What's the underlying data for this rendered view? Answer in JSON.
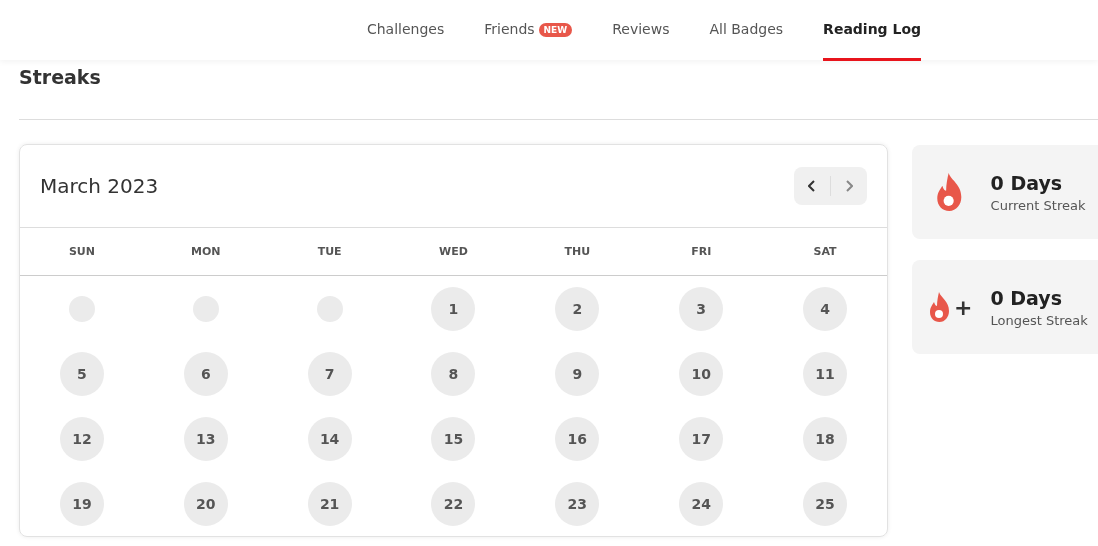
{
  "tabs": [
    {
      "label": "Challenges",
      "selected": false
    },
    {
      "label": "Friends",
      "selected": false,
      "badge": "NEW"
    },
    {
      "label": "Reviews",
      "selected": false
    },
    {
      "label": "All Badges",
      "selected": false
    },
    {
      "label": "Reading Log",
      "selected": true
    }
  ],
  "heading": "Streaks",
  "calendar": {
    "title": "March 2023",
    "weekdays": [
      "SUN",
      "MON",
      "TUE",
      "WED",
      "THU",
      "FRI",
      "SAT"
    ],
    "days": [
      {
        "kind": "blank"
      },
      {
        "kind": "blank"
      },
      {
        "kind": "blank"
      },
      {
        "kind": "day",
        "label": "1"
      },
      {
        "kind": "day",
        "label": "2"
      },
      {
        "kind": "day",
        "label": "3"
      },
      {
        "kind": "day",
        "label": "4"
      },
      {
        "kind": "day",
        "label": "5"
      },
      {
        "kind": "day",
        "label": "6"
      },
      {
        "kind": "day",
        "label": "7"
      },
      {
        "kind": "day",
        "label": "8"
      },
      {
        "kind": "day",
        "label": "9"
      },
      {
        "kind": "day",
        "label": "10"
      },
      {
        "kind": "day",
        "label": "11"
      },
      {
        "kind": "day",
        "label": "12"
      },
      {
        "kind": "day",
        "label": "13"
      },
      {
        "kind": "day",
        "label": "14"
      },
      {
        "kind": "day",
        "label": "15"
      },
      {
        "kind": "day",
        "label": "16"
      },
      {
        "kind": "day",
        "label": "17"
      },
      {
        "kind": "day",
        "label": "18"
      },
      {
        "kind": "day",
        "label": "19"
      },
      {
        "kind": "day",
        "label": "20"
      },
      {
        "kind": "day",
        "label": "21"
      },
      {
        "kind": "day",
        "label": "22"
      },
      {
        "kind": "day",
        "label": "23"
      },
      {
        "kind": "day",
        "label": "24"
      },
      {
        "kind": "day",
        "label": "25"
      }
    ]
  },
  "streaks": [
    {
      "kind": "current",
      "value": "0 Days",
      "label": "Current Streak"
    },
    {
      "kind": "longest",
      "value": "0 Days",
      "label": "Longest Streak",
      "suffix": "+"
    }
  ]
}
